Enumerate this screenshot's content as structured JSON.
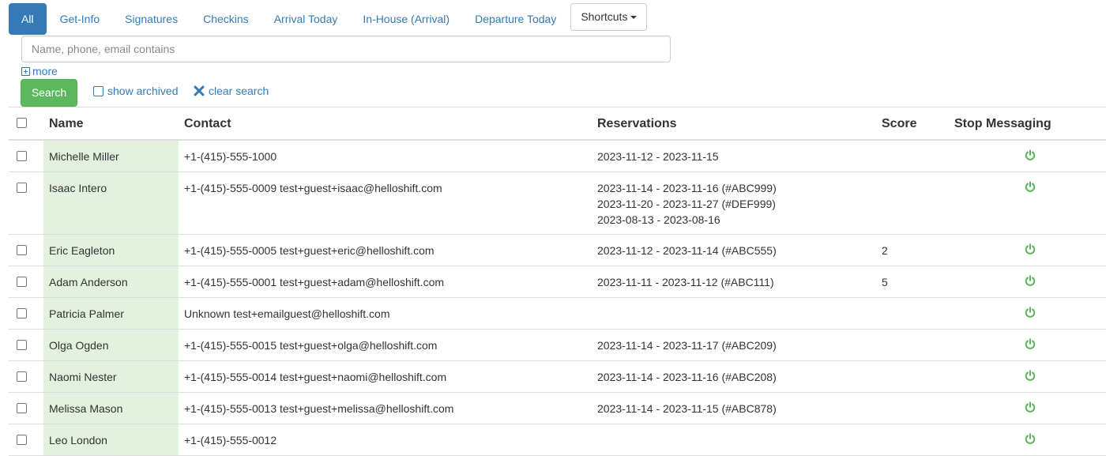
{
  "tabs": [
    {
      "label": "All",
      "active": true
    },
    {
      "label": "Get-Info"
    },
    {
      "label": "Signatures"
    },
    {
      "label": "Checkins"
    },
    {
      "label": "Arrival Today"
    },
    {
      "label": "In-House (Arrival)"
    },
    {
      "label": "Departure Today"
    }
  ],
  "shortcuts_label": "Shortcuts",
  "search": {
    "placeholder": "Name, phone, email contains",
    "more_label": "more",
    "button_label": "Search",
    "show_archived_label": "show archived",
    "clear_search_label": "clear search"
  },
  "table": {
    "headers": {
      "name": "Name",
      "contact": "Contact",
      "reservations": "Reservations",
      "score": "Score",
      "stop_messaging": "Stop Messaging"
    },
    "rows": [
      {
        "name": "Michelle Miller",
        "contact": "+1-(415)-555-1000",
        "reservations": [
          "2023-11-12 - 2023-11-15"
        ],
        "score": ""
      },
      {
        "name": "Isaac Intero",
        "contact": "+1-(415)-555-0009 test+guest+isaac@helloshift.com",
        "reservations": [
          "2023-11-14 - 2023-11-16 (#ABC999)",
          "2023-11-20 - 2023-11-27 (#DEF999)",
          "2023-08-13 - 2023-08-16"
        ],
        "score": ""
      },
      {
        "name": "Eric Eagleton",
        "contact": "+1-(415)-555-0005 test+guest+eric@helloshift.com",
        "reservations": [
          "2023-11-12 - 2023-11-14 (#ABC555)"
        ],
        "score": "2"
      },
      {
        "name": "Adam Anderson",
        "contact": "+1-(415)-555-0001 test+guest+adam@helloshift.com",
        "reservations": [
          "2023-11-11 - 2023-11-12 (#ABC111)"
        ],
        "score": "5"
      },
      {
        "name": "Patricia Palmer",
        "contact": "Unknown test+emailguest@helloshift.com",
        "reservations": [],
        "score": ""
      },
      {
        "name": "Olga Ogden",
        "contact": "+1-(415)-555-0015 test+guest+olga@helloshift.com",
        "reservations": [
          "2023-11-14 - 2023-11-17 (#ABC209)"
        ],
        "score": ""
      },
      {
        "name": "Naomi Nester",
        "contact": "+1-(415)-555-0014 test+guest+naomi@helloshift.com",
        "reservations": [
          "2023-11-14 - 2023-11-16 (#ABC208)"
        ],
        "score": ""
      },
      {
        "name": "Melissa Mason",
        "contact": "+1-(415)-555-0013 test+guest+melissa@helloshift.com",
        "reservations": [
          "2023-11-14 - 2023-11-15 (#ABC878)"
        ],
        "score": ""
      },
      {
        "name": "Leo London",
        "contact": "+1-(415)-555-0012",
        "reservations": [],
        "score": ""
      }
    ]
  },
  "colors": {
    "primary": "#337ab7",
    "success": "#5cb85c",
    "name_cell_bg": "#e3f1df",
    "power_icon": "#5cb85c"
  },
  "icons": {
    "more": "plus-square-icon",
    "clear": "x-icon",
    "stop_messaging": "power-icon",
    "shortcuts": "caret-down-icon"
  }
}
